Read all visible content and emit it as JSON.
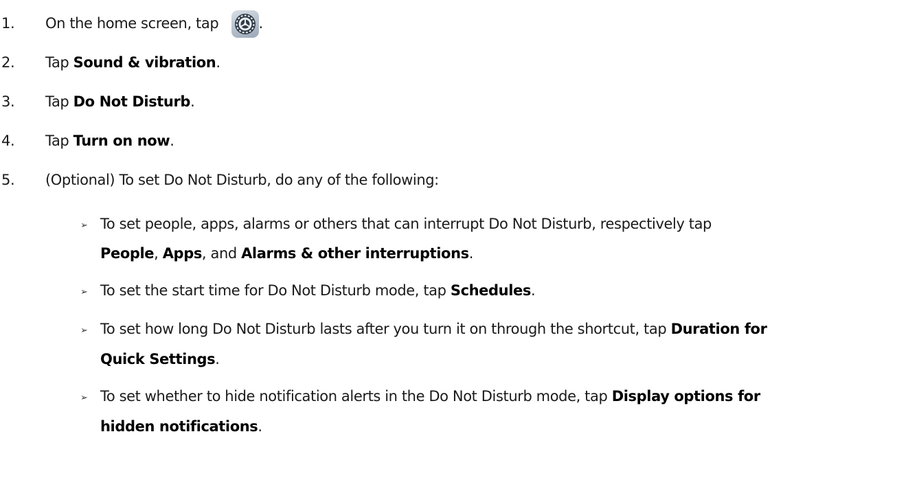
{
  "steps": [
    {
      "number": "1.",
      "text_before": "On the home screen, tap",
      "text_after": "."
    },
    {
      "number": "2.",
      "prefix": "Tap ",
      "bold": "Sound & vibration",
      "suffix": "."
    },
    {
      "number": "3.",
      "prefix": "Tap ",
      "bold": "Do Not Disturb",
      "suffix": "."
    },
    {
      "number": "4.",
      "prefix": "Tap ",
      "bold": "Turn on now",
      "suffix": "."
    },
    {
      "number": "5.",
      "text": "(Optional) To set Do Not Disturb, do any of the following:"
    }
  ],
  "bullets": [
    {
      "line1": "To set people, apps, alarms or others that can interrupt Do Not Disturb, respectively tap",
      "b1": "People",
      "sep1": ", ",
      "b2": "Apps",
      "sep2": ", and ",
      "b3": "Alarms & other interruptions",
      "end": "."
    },
    {
      "text": "To set the start time for Do Not Disturb mode, tap ",
      "bold": "Schedules",
      "end": "."
    },
    {
      "text": "To set how long Do Not Disturb lasts after you turn it on through the shortcut, tap ",
      "bold1": "Duration for",
      "bold2": "Quick Settings",
      "end": "."
    },
    {
      "text": "To set whether to hide notification alerts in the Do Not Disturb mode, tap ",
      "bold1": "Display options for",
      "bold2": "hidden notifications",
      "end": "."
    }
  ],
  "bullet_marker": "➢",
  "icons": {
    "step1": "settings-gear-icon"
  }
}
